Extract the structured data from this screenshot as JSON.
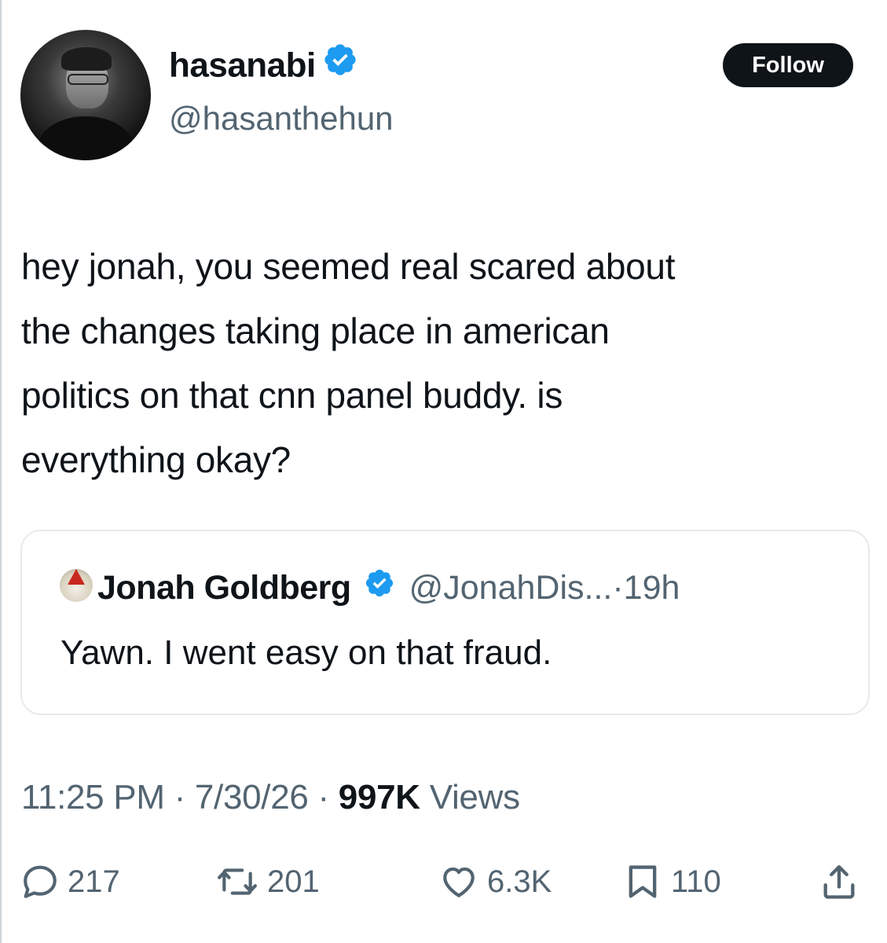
{
  "author": {
    "display_name": "hasanabi",
    "handle": "@hasanthehun",
    "verified": true
  },
  "follow_button": {
    "label": "Follow"
  },
  "tweet": {
    "lines": [
      "hey jonah, you seemed real scared about",
      "the changes taking place in american",
      "politics on that cnn panel buddy. is",
      "everything okay?"
    ]
  },
  "quoted_tweet": {
    "display_name": "Jonah Goldberg",
    "verified": true,
    "handle_time": "@JonahDis...·19h",
    "text": "Yawn. I went easy on that fraud."
  },
  "meta": {
    "time_date": "11:25 PM · 7/30/26 · ",
    "views_count": "997K",
    "views_label": " Views"
  },
  "actions": {
    "replies": "217",
    "reposts": "201",
    "likes": "6.3K",
    "bookmarks": "110"
  },
  "colors": {
    "text": "#0f1419",
    "secondary": "#536471",
    "verified_blue": "#1d9bf0",
    "follow_bg": "#0f1419",
    "border": "#e7e9ea"
  }
}
